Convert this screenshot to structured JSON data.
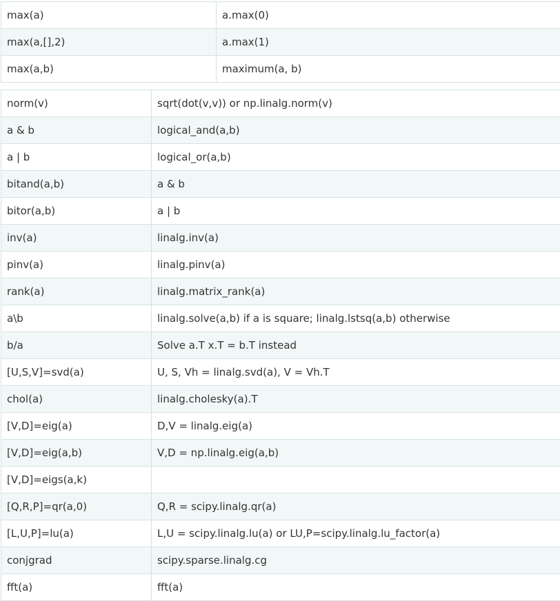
{
  "top_table": {
    "rows": [
      {
        "matlab": "max(a)",
        "numpy": "a.max(0)"
      },
      {
        "matlab": "max(a,[],2)",
        "numpy": "a.max(1)"
      },
      {
        "matlab": "max(a,b)",
        "numpy": "maximum(a, b)"
      }
    ]
  },
  "bottom_table": {
    "rows": [
      {
        "matlab": "norm(v)",
        "numpy": "sqrt(dot(v,v)) or np.linalg.norm(v)"
      },
      {
        "matlab": "a & b",
        "numpy": "logical_and(a,b)"
      },
      {
        "matlab": "a | b",
        "numpy": "logical_or(a,b)"
      },
      {
        "matlab": "bitand(a,b)",
        "numpy": "a & b"
      },
      {
        "matlab": "bitor(a,b)",
        "numpy": "a | b"
      },
      {
        "matlab": "inv(a)",
        "numpy": "linalg.inv(a)"
      },
      {
        "matlab": "pinv(a)",
        "numpy": "linalg.pinv(a)"
      },
      {
        "matlab": "rank(a)",
        "numpy": "linalg.matrix_rank(a)"
      },
      {
        "matlab": "a\\b",
        "numpy": "linalg.solve(a,b) if a is square; linalg.lstsq(a,b) otherwise"
      },
      {
        "matlab": "b/a",
        "numpy": "Solve a.T x.T = b.T instead"
      },
      {
        "matlab": "[U,S,V]=svd(a)",
        "numpy": "U, S, Vh = linalg.svd(a), V = Vh.T"
      },
      {
        "matlab": "chol(a)",
        "numpy": "linalg.cholesky(a).T"
      },
      {
        "matlab": "[V,D]=eig(a)",
        "numpy": "D,V = linalg.eig(a)"
      },
      {
        "matlab": "[V,D]=eig(a,b)",
        "numpy": "V,D = np.linalg.eig(a,b)"
      },
      {
        "matlab": "[V,D]=eigs(a,k)",
        "numpy": ""
      },
      {
        "matlab": "[Q,R,P]=qr(a,0)",
        "numpy": "Q,R = scipy.linalg.qr(a)"
      },
      {
        "matlab": "[L,U,P]=lu(a)",
        "numpy": "L,U = scipy.linalg.lu(a) or LU,P=scipy.linalg.lu_factor(a)"
      },
      {
        "matlab": "conjgrad",
        "numpy": "scipy.sparse.linalg.cg"
      },
      {
        "matlab": "fft(a)",
        "numpy": "fft(a)"
      }
    ]
  }
}
